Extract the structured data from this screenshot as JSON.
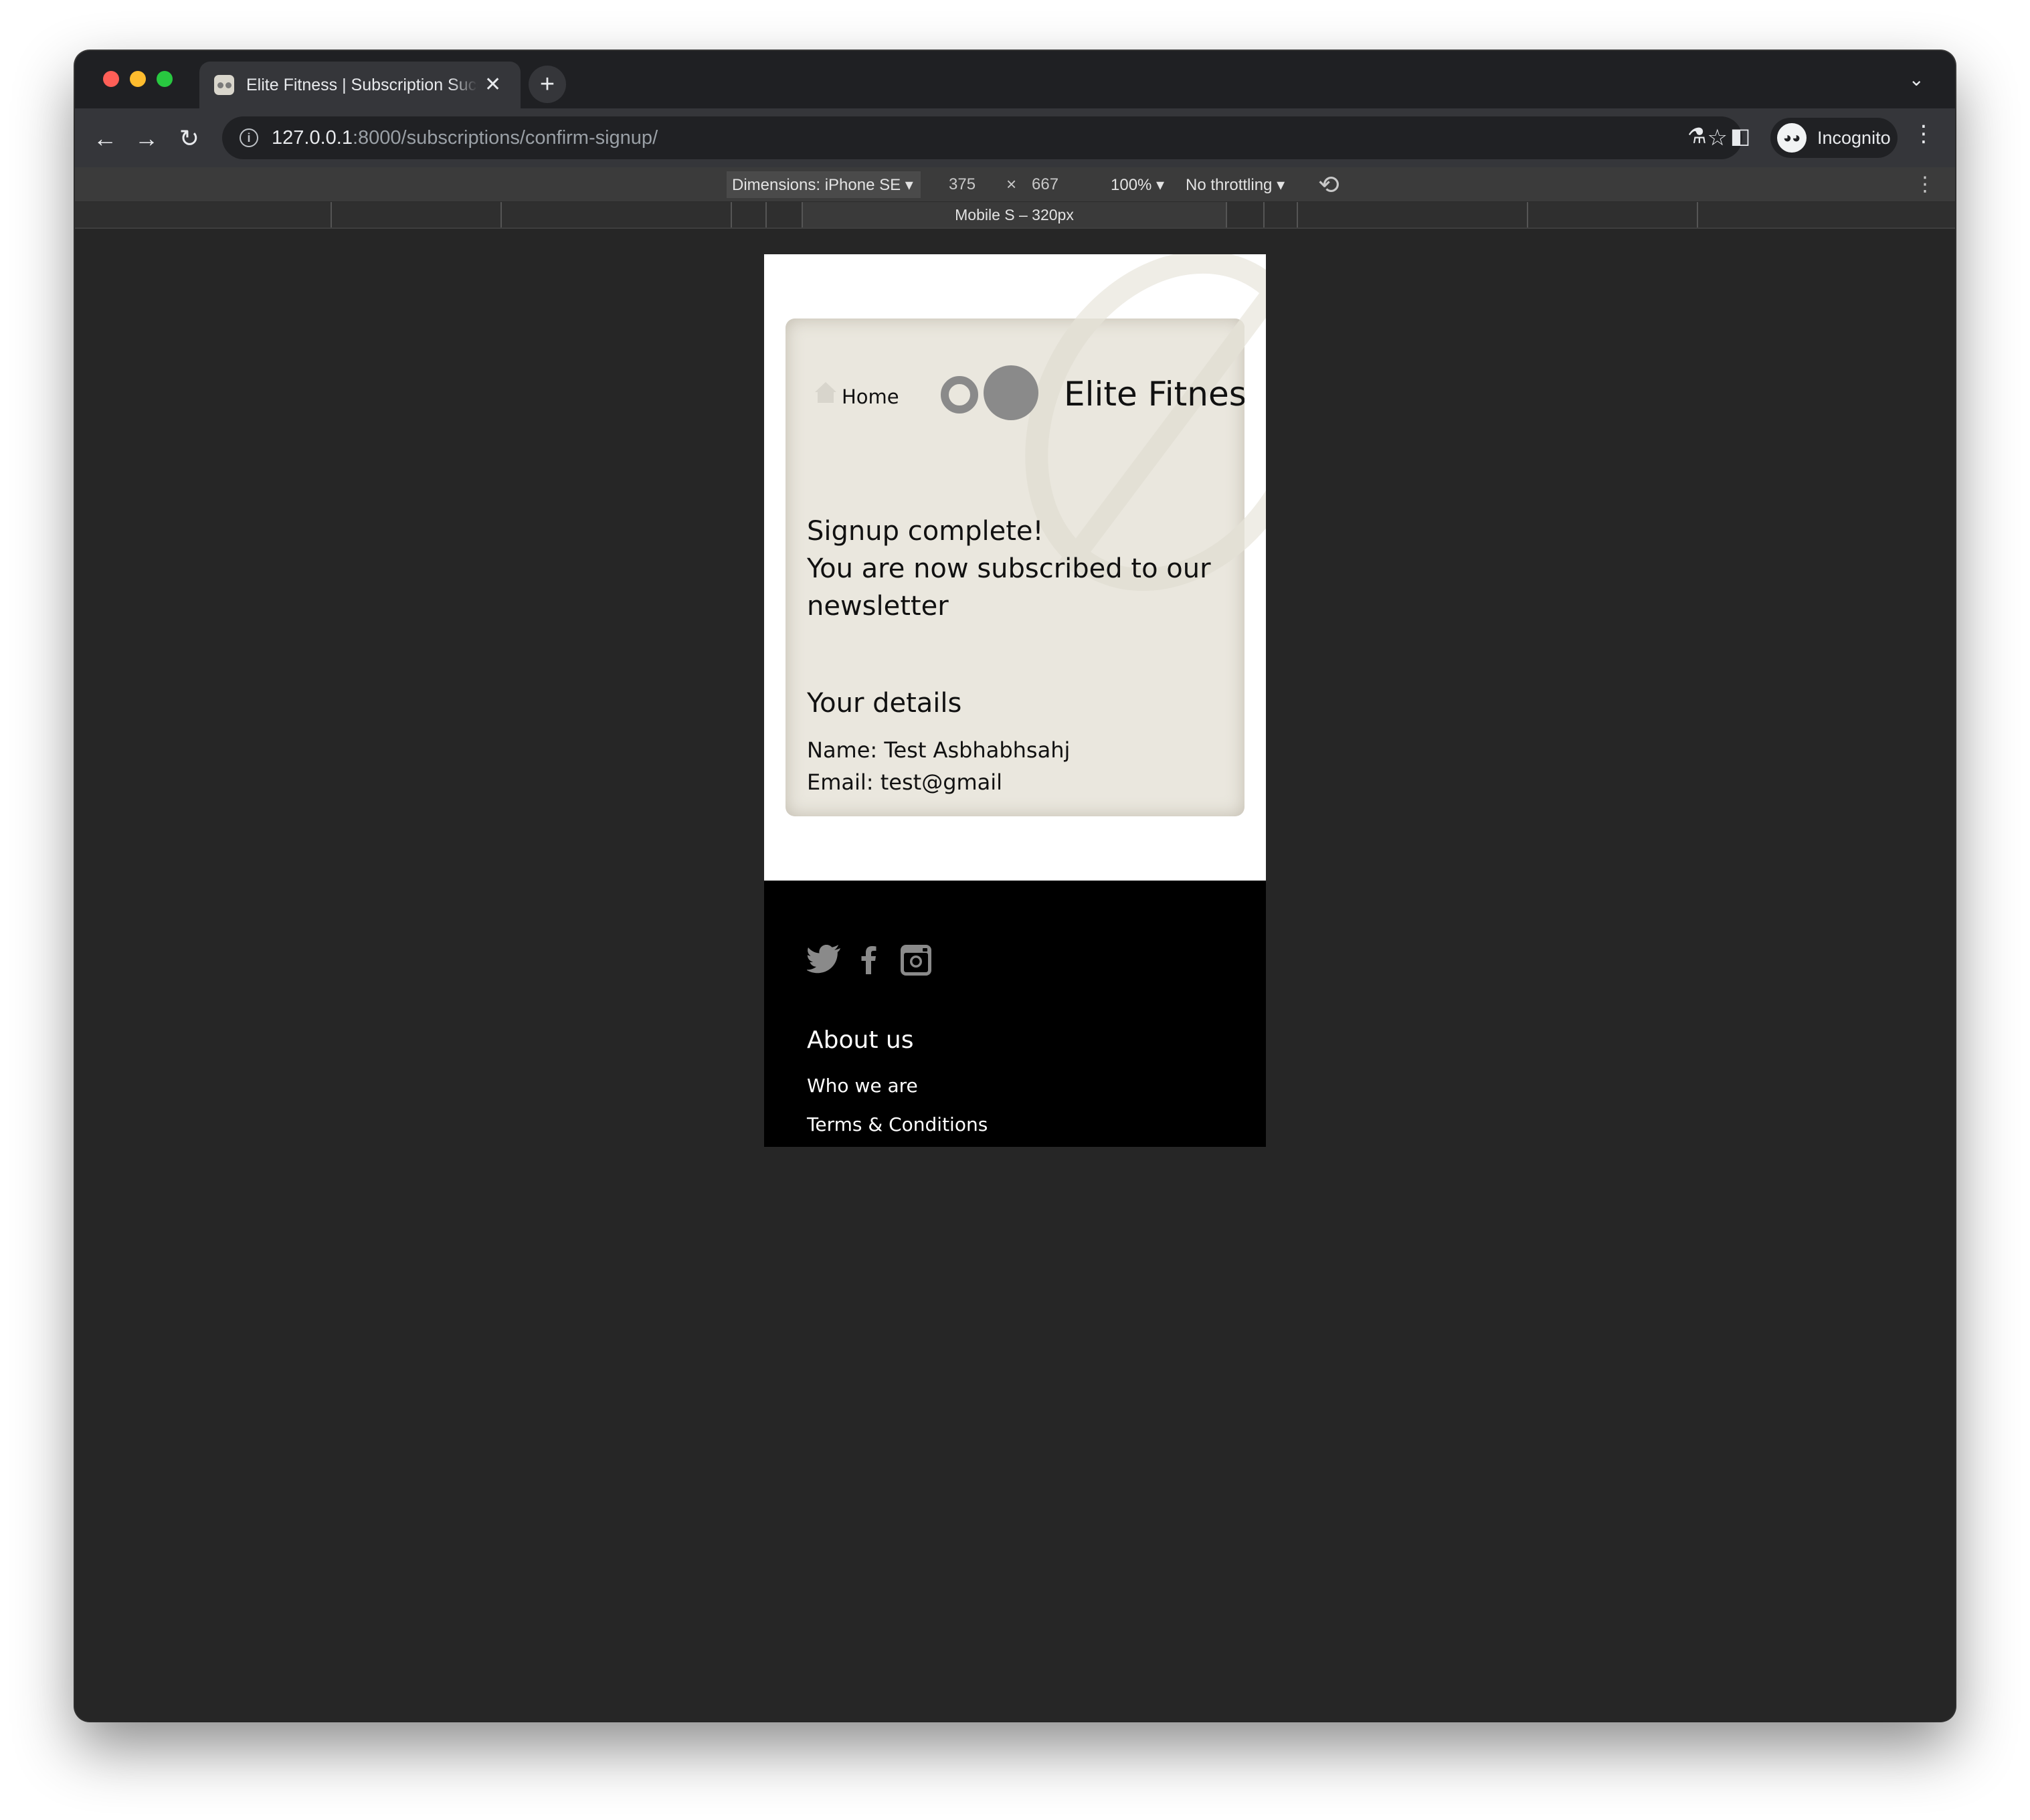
{
  "browser": {
    "tab_title": "Elite Fitness | Subscription Success",
    "tab_close": "✕",
    "new_tab": "+",
    "url_host": "127.0.0.1",
    "url_rest": ":8000/subscriptions/confirm-signup/",
    "profile_label": "Incognito"
  },
  "devtools": {
    "dimensions_label": "Dimensions: iPhone SE ▾",
    "width": "375",
    "times": "×",
    "height": "667",
    "zoom": "100% ▾",
    "throttling": "No throttling ▾",
    "media_query_label": "Mobile S – 320px"
  },
  "page": {
    "nav": {
      "home_label": "Home",
      "brand": "Elite Fitness"
    },
    "confirmation": {
      "line1": "Signup complete!",
      "line2": "You are now subscribed to our newsletter"
    },
    "details": {
      "title": "Your details",
      "name": "Name: Test Asbhabhsahj",
      "email": "Email: test@gmail"
    },
    "footer": {
      "social_icons": [
        "twitter-icon",
        "facebook-icon",
        "instagram-icon"
      ],
      "about_title": "About us",
      "links": [
        "Who we are",
        "Terms & Conditions"
      ]
    }
  },
  "colors": {
    "card_bg": "#eae7de",
    "footer_bg": "#000000",
    "logo_grey": "#8a8a8a",
    "devtools_bg": "#262626"
  }
}
